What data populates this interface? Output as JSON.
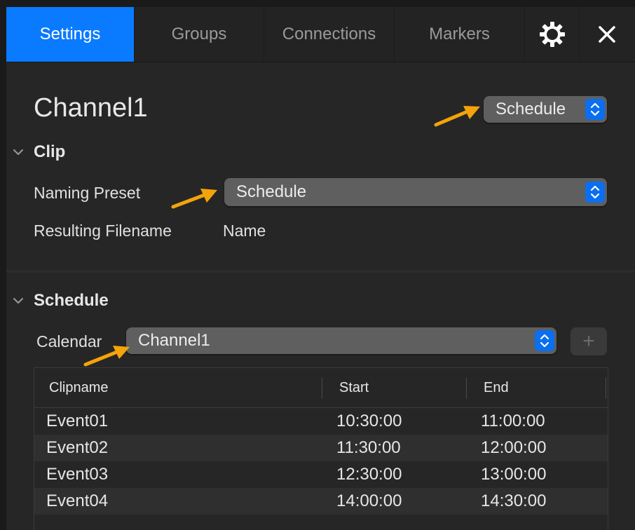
{
  "tabs": [
    {
      "label": "Settings",
      "active": true
    },
    {
      "label": "Groups",
      "active": false
    },
    {
      "label": "Connections",
      "active": false
    },
    {
      "label": "Markers",
      "active": false
    }
  ],
  "icons": {
    "settings": "gear-icon",
    "close": "close-icon"
  },
  "channel": {
    "title": "Channel1",
    "mode_value": "Schedule"
  },
  "clip": {
    "section_label": "Clip",
    "naming_preset_label": "Naming Preset",
    "naming_preset_value": "Schedule",
    "resulting_filename_label": "Resulting Filename",
    "resulting_filename_value": "Name"
  },
  "schedule": {
    "section_label": "Schedule",
    "calendar_label": "Calendar",
    "calendar_value": "Channel1",
    "add_label": "+",
    "columns": [
      "Clipname",
      "Start",
      "End"
    ],
    "rows": [
      {
        "clipname": "Event01",
        "start": "10:30:00",
        "end": "11:00:00"
      },
      {
        "clipname": "Event02",
        "start": "11:30:00",
        "end": "12:00:00"
      },
      {
        "clipname": "Event03",
        "start": "12:30:00",
        "end": "13:00:00"
      },
      {
        "clipname": "Event04",
        "start": "14:00:00",
        "end": "14:30:00"
      }
    ]
  },
  "colors": {
    "accent": "#0a7aff",
    "annotation_arrow": "#f5a30a"
  }
}
